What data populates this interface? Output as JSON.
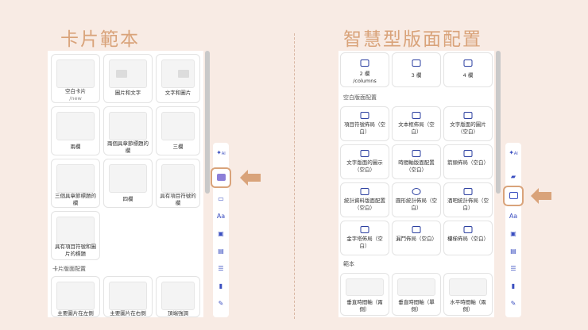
{
  "left": {
    "title": "卡片範本",
    "cards": [
      {
        "label": "空白卡片",
        "sub": "/new"
      },
      {
        "label": "圖片和文字"
      },
      {
        "label": "文字和圖片"
      },
      {
        "label": "兩欄"
      },
      {
        "label": "兩個具章節標題的欄"
      },
      {
        "label": "三欄"
      },
      {
        "label": "三個具章節標題的欄"
      },
      {
        "label": "四欄"
      },
      {
        "label": "具有項目符號的欄"
      },
      {
        "label": "具有項目符號和圖片的標題"
      }
    ],
    "section": "卡片版面配置",
    "bottom_cards": [
      "主要圖片在左側",
      "主要圖片在右側",
      "頂端強調"
    ]
  },
  "right": {
    "title": "智慧型版面配置",
    "columns": [
      {
        "label": "2 欄",
        "sub": "/columns"
      },
      {
        "label": "3 欄"
      },
      {
        "label": "4 欄"
      }
    ],
    "section1": "空白版面配置",
    "layouts": [
      "項目符號佈局（空白）",
      "文本框佈局（空白）",
      "文字版面的圖片（空白）",
      "文字版面的圖示（空白）",
      "時間軸版面配置（空白）",
      "箭頭佈局（空白）",
      "統計資料版面配置（空白）",
      "圓形統計佈局（空白）",
      "酒吧統計佈局（空白）",
      "金字塔佈局（空白）",
      "漏鬥佈局（空白）",
      "樓梯佈局（空白）"
    ],
    "section2": "範本",
    "templates": [
      "垂直時間軸（兩側）",
      "垂直時間軸（單側）",
      "水平時間軸（兩側）"
    ]
  },
  "toolbar": {
    "ai_label": "AI",
    "text_label": "Aa"
  },
  "colors": {
    "accent": "#d9a37a",
    "icon": "#3b4fc0"
  }
}
